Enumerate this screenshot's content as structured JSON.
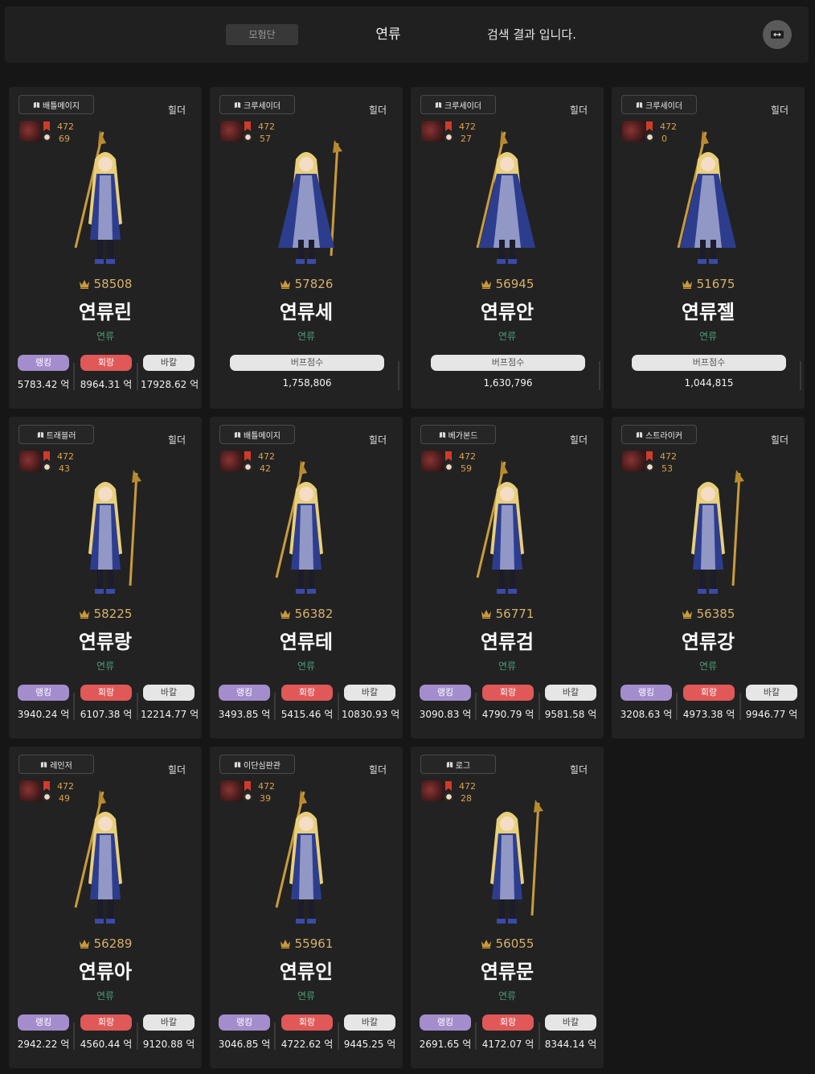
{
  "header": {
    "adventure_label": "모험단",
    "search_term": "연류",
    "result_text": "검색 결과 입니다."
  },
  "colors": {
    "background": "#161616",
    "card": "#222222",
    "ranking": "#a48dcc",
    "damage": "#e05858",
    "bakal": "#e6e6e6",
    "guild": "#4c9c78",
    "score": "#d7b06a",
    "fame": "#d9a24a"
  },
  "icons": {
    "toggle": "swap-arrows-icon",
    "score": "crown-icon",
    "job": "book-icon"
  },
  "labels": {
    "ranking": "랭킹",
    "damage": "회랑",
    "bakal": "바칼",
    "buff": "버프점수"
  },
  "cards": [
    {
      "job": "배틀메이지",
      "role": "힐더",
      "fame": "472",
      "level": "69",
      "score": "58508",
      "name": "연류린",
      "guild": "연류",
      "type": "dealer",
      "ranking": "5783.42 억",
      "damage": "8964.31 억",
      "bakal": "17928.62 억"
    },
    {
      "job": "크루세이더",
      "role": "힐더",
      "fame": "472",
      "level": "57",
      "score": "57826",
      "name": "연류세",
      "guild": "연류",
      "type": "buffer",
      "buff": "1,758,806"
    },
    {
      "job": "크루세이더",
      "role": "힐더",
      "fame": "472",
      "level": "27",
      "score": "56945",
      "name": "연류안",
      "guild": "연류",
      "type": "buffer",
      "buff": "1,630,796"
    },
    {
      "job": "크루세이더",
      "role": "힐더",
      "fame": "472",
      "level": "0",
      "score": "51675",
      "name": "연류젤",
      "guild": "연류",
      "type": "buffer",
      "buff": "1,044,815"
    },
    {
      "job": "트래블러",
      "role": "힐더",
      "fame": "472",
      "level": "43",
      "score": "58225",
      "name": "연류랑",
      "guild": "연류",
      "type": "dealer",
      "ranking": "3940.24 억",
      "damage": "6107.38 억",
      "bakal": "12214.77 억"
    },
    {
      "job": "배틀메이지",
      "role": "힐더",
      "fame": "472",
      "level": "42",
      "score": "56382",
      "name": "연류테",
      "guild": "연류",
      "type": "dealer",
      "ranking": "3493.85 억",
      "damage": "5415.46 억",
      "bakal": "10830.93 억"
    },
    {
      "job": "베가본드",
      "role": "힐더",
      "fame": "472",
      "level": "59",
      "score": "56771",
      "name": "연류검",
      "guild": "연류",
      "type": "dealer",
      "ranking": "3090.83 억",
      "damage": "4790.79 억",
      "bakal": "9581.58 억"
    },
    {
      "job": "스트라이커",
      "role": "힐더",
      "fame": "472",
      "level": "53",
      "score": "56385",
      "name": "연류강",
      "guild": "연류",
      "type": "dealer",
      "ranking": "3208.63 억",
      "damage": "4973.38 억",
      "bakal": "9946.77 억"
    },
    {
      "job": "레인저",
      "role": "힐더",
      "fame": "472",
      "level": "49",
      "score": "56289",
      "name": "연류아",
      "guild": "연류",
      "type": "dealer",
      "ranking": "2942.22 억",
      "damage": "4560.44 억",
      "bakal": "9120.88 억"
    },
    {
      "job": "이단심판관",
      "role": "힐더",
      "fame": "472",
      "level": "39",
      "score": "55961",
      "name": "연류인",
      "guild": "연류",
      "type": "dealer",
      "ranking": "3046.85 억",
      "damage": "4722.62 억",
      "bakal": "9445.25 억"
    },
    {
      "job": "로그",
      "role": "힐더",
      "fame": "472",
      "level": "28",
      "score": "56055",
      "name": "연류문",
      "guild": "연류",
      "type": "dealer",
      "ranking": "2691.65 억",
      "damage": "4172.07 억",
      "bakal": "8344.14 억"
    }
  ]
}
